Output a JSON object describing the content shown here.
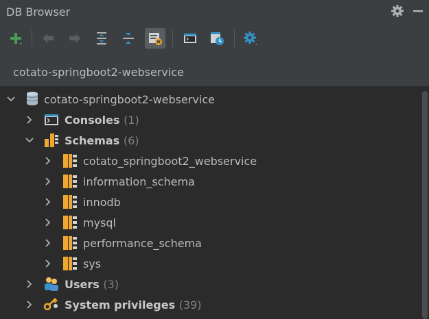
{
  "window": {
    "title": "DB Browser"
  },
  "connection": {
    "label": "cotato-springboot2-webservice"
  },
  "tree": {
    "root": {
      "label": "cotato-springboot2-webservice"
    },
    "consoles": {
      "label": "Consoles",
      "count": "(1)"
    },
    "schemas": {
      "label": "Schemas",
      "count": "(6)"
    },
    "schema_items": [
      "cotato_springboot2_webservice",
      "information_schema",
      "innodb",
      "mysql",
      "performance_schema",
      "sys"
    ],
    "users": {
      "label": "Users",
      "count": "(3)"
    },
    "privileges": {
      "label": "System privileges",
      "count": "(39)"
    }
  },
  "icons": {
    "add": "plus-icon",
    "back": "arrow-left-icon",
    "forward": "arrow-right-icon",
    "expand": "expand-all-icon",
    "collapse": "collapse-all-icon",
    "filter": "filter-icon",
    "console": "console-icon",
    "history": "history-icon",
    "settings": "gear-icon"
  },
  "colors": {
    "accent_green": "#499c54",
    "accent_blue": "#3592c4",
    "schema_orange": "#f0a732"
  }
}
